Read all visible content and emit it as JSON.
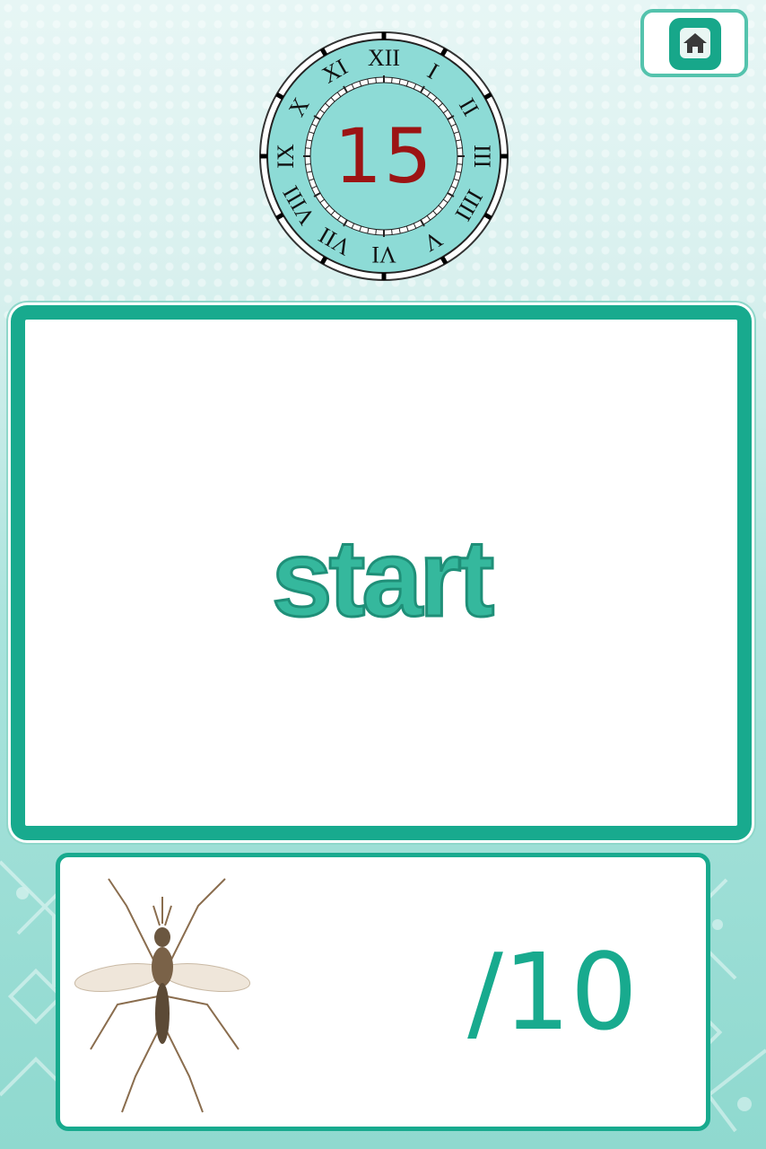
{
  "header": {
    "home_icon": "home-icon"
  },
  "timer": {
    "value": "15",
    "numerals": [
      "XII",
      "I",
      "II",
      "III",
      "IIII",
      "V",
      "VI",
      "VII",
      "VIII",
      "IX",
      "X",
      "XI"
    ]
  },
  "word_card": {
    "word": "start"
  },
  "score_card": {
    "image": "mosquito",
    "score": "/10"
  },
  "colors": {
    "accent": "#18aa8e",
    "word": "#35b89d",
    "timer_text": "#9c1414",
    "clock_face": "#8ddbd6"
  }
}
